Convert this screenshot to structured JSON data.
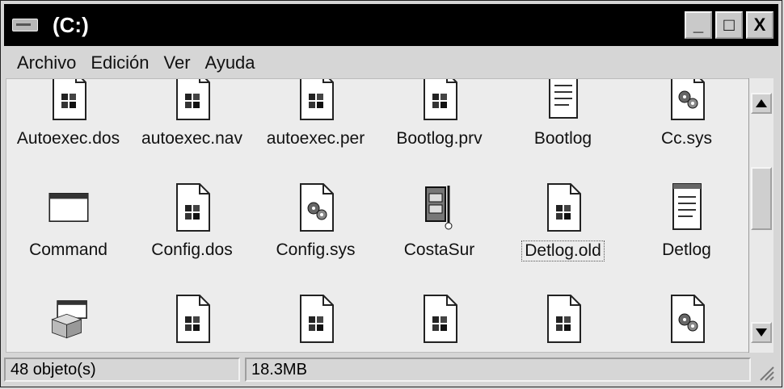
{
  "window": {
    "title": "(C:)",
    "buttons": {
      "minimize": "_",
      "maximize": "□",
      "close": "X"
    }
  },
  "menubar": {
    "items": [
      {
        "label": "Archivo"
      },
      {
        "label": "Edición"
      },
      {
        "label": "Ver"
      },
      {
        "label": "Ayuda"
      }
    ]
  },
  "files": [
    {
      "name": "Autoexec.dos",
      "icon": "windows-file-icon"
    },
    {
      "name": "autoexec.nav",
      "icon": "windows-file-icon"
    },
    {
      "name": "autoexec.per",
      "icon": "windows-file-icon"
    },
    {
      "name": "Bootlog.prv",
      "icon": "windows-file-icon"
    },
    {
      "name": "Bootlog",
      "icon": "text-document-icon"
    },
    {
      "name": "Cc.sys",
      "icon": "system-gear-file-icon"
    },
    {
      "name": "Command",
      "icon": "dos-window-icon"
    },
    {
      "name": "Config.dos",
      "icon": "windows-file-icon"
    },
    {
      "name": "Config.sys",
      "icon": "system-gear-file-icon"
    },
    {
      "name": "CostaSur",
      "icon": "compressed-archive-icon"
    },
    {
      "name": "Detlog.old",
      "icon": "windows-file-icon",
      "selected": true
    },
    {
      "name": "Detlog",
      "icon": "text-document-icon"
    },
    {
      "name": "",
      "icon": "setup-box-icon"
    },
    {
      "name": "",
      "icon": "windows-file-icon"
    },
    {
      "name": "",
      "icon": "windows-file-icon"
    },
    {
      "name": "",
      "icon": "windows-file-icon"
    },
    {
      "name": "",
      "icon": "windows-file-icon"
    },
    {
      "name": "",
      "icon": "system-gear-file-icon"
    }
  ],
  "status": {
    "objects": "48 objeto(s)",
    "size": "18.3MB"
  },
  "scrollbar": {
    "up": "▲",
    "down": "▼"
  }
}
